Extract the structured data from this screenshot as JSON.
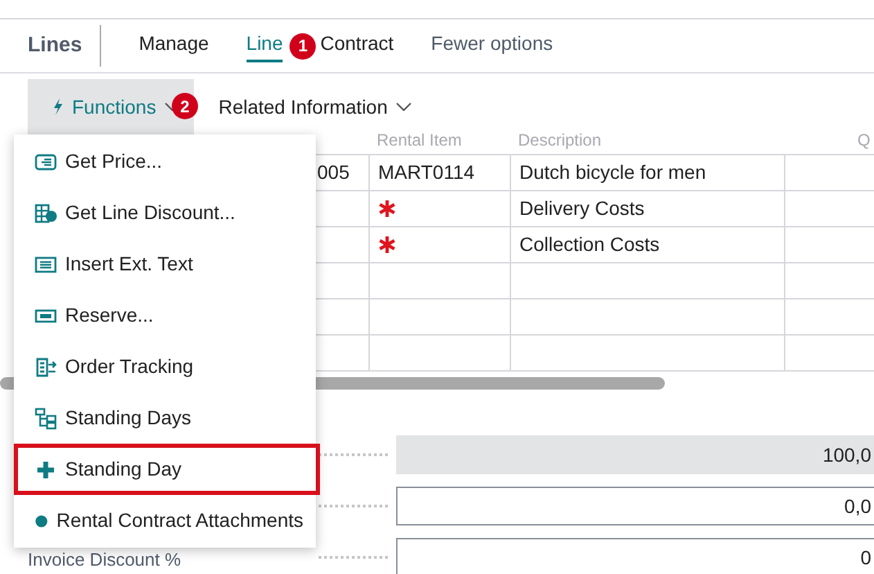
{
  "page_title": "Lines",
  "tabs": [
    {
      "label": "Manage",
      "selected": false,
      "kind": "tab"
    },
    {
      "label": "Line",
      "selected": true,
      "kind": "tab",
      "badge": "1"
    },
    {
      "label": "Contract",
      "selected": false,
      "kind": "tab"
    },
    {
      "label": "Fewer options",
      "selected": false,
      "kind": "toggle"
    }
  ],
  "actions": [
    {
      "label": "Functions",
      "kind": "icon-menu",
      "open": true,
      "badge": "2"
    },
    {
      "label": "Related Information",
      "kind": "menu",
      "open": false
    }
  ],
  "table": {
    "columns": [
      "Rental Item",
      "Description",
      "Q"
    ],
    "rows": [
      {
        "kind": "line",
        "no": "005",
        "rental_item": "MART0114",
        "description": "Dutch bicycle for men",
        "item_missing": false
      },
      {
        "kind": "line",
        "description": "Delivery Costs",
        "item_missing": true
      },
      {
        "kind": "line",
        "description": "Collection Costs",
        "item_missing": true
      },
      {
        "kind": "empty"
      },
      {
        "kind": "empty"
      },
      {
        "kind": "empty"
      }
    ]
  },
  "fields": [
    {
      "value": "100,0",
      "editable": false
    },
    {
      "value": "0,0",
      "editable": true
    },
    {
      "label": "Invoice Discount %",
      "value": "0",
      "editable": true
    }
  ],
  "menu": {
    "items": [
      {
        "label": "Get Price...",
        "kind": "tag",
        "highlighted": false
      },
      {
        "label": "Get Line Discount...",
        "kind": "discount",
        "highlighted": false
      },
      {
        "label": "Insert Ext. Text",
        "kind": "list",
        "highlighted": false
      },
      {
        "label": "Reserve...",
        "kind": "reserve",
        "highlighted": false
      },
      {
        "label": "Order Tracking",
        "kind": "tracking",
        "highlighted": false
      },
      {
        "label": "Standing Days",
        "kind": "tree",
        "highlighted": false
      },
      {
        "label": "Standing Day",
        "kind": "plus",
        "highlighted": true
      },
      {
        "label": "Rental Contract Attachments",
        "kind": "circle",
        "highlighted": false
      }
    ]
  }
}
